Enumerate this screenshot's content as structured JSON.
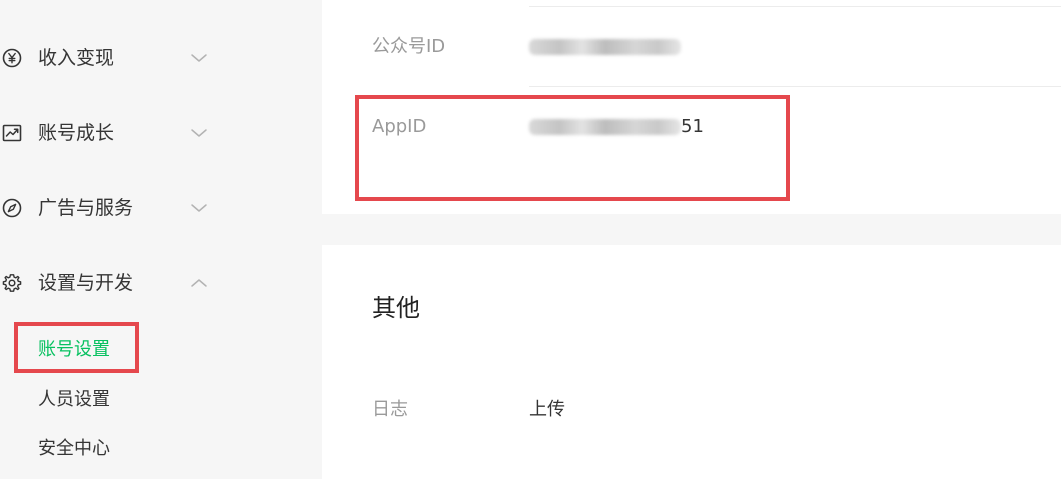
{
  "sidebar": {
    "groups": [
      {
        "label": "收入变现",
        "icon": "yen-circle-icon",
        "expanded": false
      },
      {
        "label": "账号成长",
        "icon": "trend-chart-icon",
        "expanded": false
      },
      {
        "label": "广告与服务",
        "icon": "compass-icon",
        "expanded": false
      },
      {
        "label": "设置与开发",
        "icon": "gear-icon",
        "expanded": true
      }
    ],
    "sub_items": [
      {
        "label": "账号设置",
        "active": true
      },
      {
        "label": "人员设置",
        "active": false
      },
      {
        "label": "安全中心",
        "active": false
      }
    ]
  },
  "account_info": {
    "rows": [
      {
        "label": "公众号ID",
        "value_masked": true,
        "value_suffix": ""
      },
      {
        "label": "AppID",
        "value_masked": true,
        "value_suffix": "51"
      }
    ]
  },
  "other": {
    "title": "其他",
    "rows": [
      {
        "label": "日志",
        "value": "上传"
      }
    ]
  },
  "colors": {
    "active": "#07c160",
    "highlight": "#e5484d",
    "label_gray": "#9a9a9a",
    "text": "#353535"
  }
}
